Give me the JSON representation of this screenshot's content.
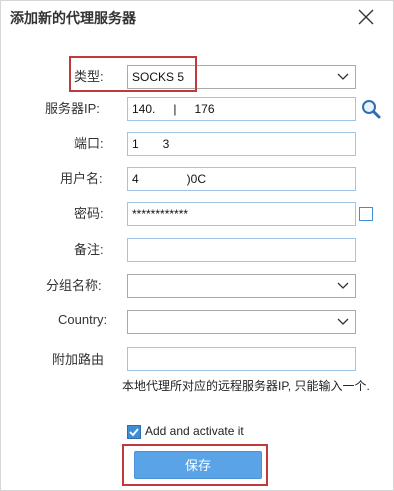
{
  "dialog": {
    "title": "添加新的代理服务器",
    "close_icon": "close-icon"
  },
  "fields": {
    "type": {
      "label": "类型:",
      "value": "SOCKS 5"
    },
    "server_ip": {
      "label": "服务器IP:",
      "value": "140.   |   176"
    },
    "port": {
      "label": "端口:",
      "value": "1  3"
    },
    "username": {
      "label": "用户名:",
      "value": "4    )0C"
    },
    "password": {
      "label": "密码:",
      "value": "************"
    },
    "note": {
      "label": "备注:",
      "value": ""
    },
    "group": {
      "label": "分组名称:",
      "value": ""
    },
    "country": {
      "label": "Country:",
      "value": ""
    },
    "route": {
      "label": "附加路由",
      "value": ""
    }
  },
  "hint": "本地代理所对应的远程服务器IP, 只能输入一个.",
  "activate": {
    "label": "Add and activate it",
    "checked": true
  },
  "save_label": "保存",
  "colors": {
    "accent": "#5aa3e6",
    "highlight": "#c0393b",
    "field_border": "#9ec4e8"
  },
  "icons": {
    "search": "search-icon",
    "chevron": "chevron-down-icon",
    "check": "check-icon"
  }
}
